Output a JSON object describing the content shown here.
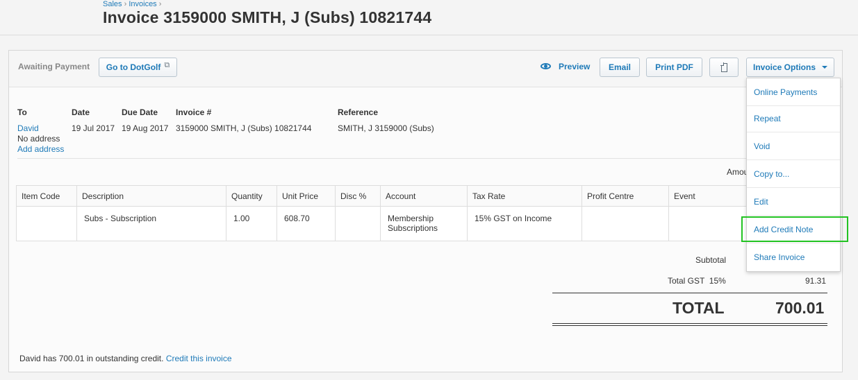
{
  "breadcrumb": {
    "items": [
      "Sales",
      "Invoices"
    ],
    "separator": "›"
  },
  "page_title": "Invoice 3159000 SMITH, J (Subs) 10821744",
  "status": "Awaiting Payment",
  "toolbar": {
    "dotgolf_label": "Go to DotGolf",
    "preview_label": "Preview",
    "email_label": "Email",
    "print_label": "Print PDF",
    "options_label": "Invoice Options"
  },
  "header_fields": {
    "to_label": "To",
    "to_name": "David",
    "to_address": "No address",
    "add_address": "Add address",
    "date_label": "Date",
    "date_value": "19 Jul 2017",
    "due_label": "Due Date",
    "due_value": "19 Aug 2017",
    "invoice_label": "Invoice #",
    "invoice_value": "3159000 SMITH, J (Subs) 10821744",
    "reference_label": "Reference",
    "reference_value": "SMITH, J 3159000 (Subs)",
    "amounts_label": "Amou"
  },
  "table": {
    "columns": [
      "Item Code",
      "Description",
      "Quantity",
      "Unit Price",
      "Disc %",
      "Account",
      "Tax Rate",
      "Profit Centre",
      "Event"
    ],
    "rows": [
      {
        "item_code": "",
        "description": "Subs - Subscription",
        "quantity": "1.00",
        "unit_price": "608.70",
        "disc": "",
        "account_line1": "Membership",
        "account_line2": "Subscriptions",
        "tax_rate": "15% GST on Income",
        "profit_centre": "",
        "event": ""
      }
    ]
  },
  "totals": {
    "subtotal_label": "Subtotal",
    "gst_label": "Total GST  15%",
    "gst_value": "91.31",
    "total_label": "TOTAL",
    "total_value": "700.01"
  },
  "footer": {
    "text": "David has 700.01 in outstanding credit.",
    "link": "Credit this invoice"
  },
  "dropdown": {
    "items": [
      "Online Payments",
      "Repeat",
      "Void",
      "Copy to...",
      "Edit",
      "Add Credit Note",
      "Share Invoice"
    ],
    "highlighted": "Add Credit Note",
    "highlight_color": "#22c322"
  },
  "colors": {
    "link": "#1e7ab8",
    "text": "#333333",
    "background": "#f4f4f4"
  }
}
